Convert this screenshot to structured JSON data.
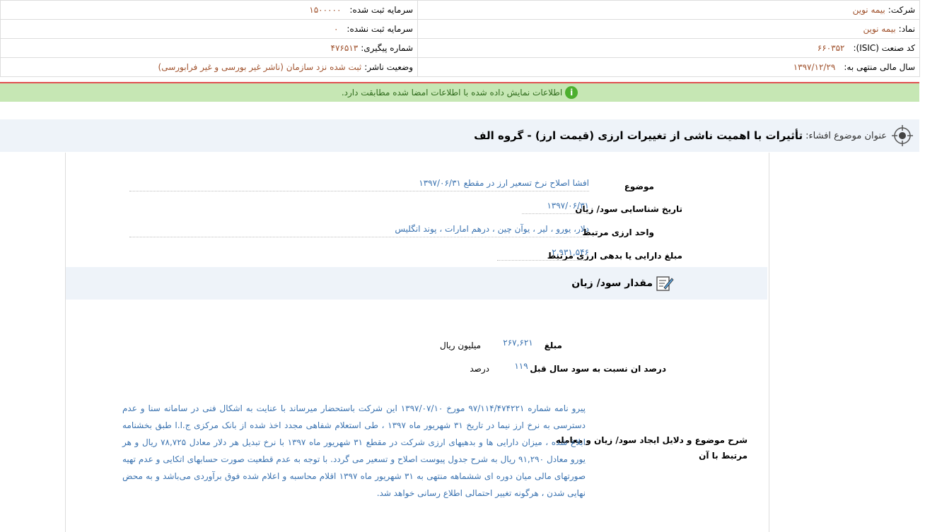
{
  "header": {
    "company_label": "شرکت:",
    "company_value": "بیمه نوین",
    "registered_capital_label": "سرمایه ثبت شده:",
    "registered_capital_value": "۱۵۰۰۰۰۰",
    "symbol_label": "نماد:",
    "symbol_value": "بیمه نوین",
    "unregistered_capital_label": "سرمایه ثبت نشده:",
    "unregistered_capital_value": "۰",
    "isic_label": "کد صنعت (ISIC):",
    "isic_value": "۶۶۰۳۵۲",
    "tracking_label": "شماره پیگیری:",
    "tracking_value": "۴۷۶۵۱۳",
    "fiscal_label": "سال مالی منتهی به:",
    "fiscal_value": "۱۳۹۷/۱۲/۲۹",
    "publisher_label": "وضعیت ناشر:",
    "publisher_value": "ثبت شده نزد سازمان (ناشر غیر بورسی و غیر فرابورسی)"
  },
  "notice": {
    "text": "اطلاعات نمایش داده شده با اطلاعات امضا شده مطابقت دارد.",
    "icon": "info-icon",
    "color": "#c6e7b4"
  },
  "title": {
    "label": "عنوان موضوع افشاء:",
    "text": "تأثیرات با اهمیت ناشی از تغییرات ارزی (قیمت ارز) - گروه الف"
  },
  "details": {
    "subject_label": "موضوع",
    "subject_value": "افشا اصلاح نرخ تسعیر ارز در مقطع ۱۳۹۷/۰۶/۳۱",
    "date_label": "تاریخ شناسایی سود/ زیان",
    "date_value": "۱۳۹۷/۰۶/۳۱",
    "currency_label": "واحد ارزی مرتبط",
    "currency_value": "دلار، یورو ، لیر ، یوآن چین ، درهم امارات ، پوند انگلیس",
    "amount_label": "مبلغ دارایی یا بدهی ارزی مرتبط",
    "amount_value": "۲,۹۳۱,۵۴۶"
  },
  "profit_section": {
    "title": "مقدار سود/ زیان",
    "amount_label": "مبلغ",
    "amount_value": "۲۶۷,۶۲۱",
    "amount_unit": "میلیون ریال",
    "percent_label": "درصد ان نسبت به سود سال قبل",
    "percent_value": "۱۱۹",
    "percent_unit": "درصد"
  },
  "description": {
    "label_line1": "شرح موضوع و دلایل ایجاد سود/ زیان و معامله",
    "label_line2": "مرتبط با آن",
    "text": "پیرو نامه شماره ۹۷/۱۱۴/۴۷۴۲۲۱ مورخ ۱۳۹۷/۰۷/۱۰ این شرکت باستحضار میرساند با عنایت به اشکال فنی در سامانه سنا و عدم دسترسی به نرخ ارز نیما در تاریخ ۳۱ شهریور ماه ۱۳۹۷ ، طی استعلام شفاهی مجدد اخذ شده از بانک مرکزی ج.ا.ا طبق بخشنامه ابلاغ شده ، میزان دارایی ها و بدهیهای ارزی شرکت در مقطع ۳۱ شهریور ماه ۱۳۹۷ با نرخ تبدیل هر دلار معادل ۷۸,۷۲۵ ریال و هر یورو معادل ۹۱,۲۹۰ ریال به شرح جدول پیوست اصلاح و تسعیر می گردد. با توجه به عدم قطعیت صورت حسابهای اتکایی و عدم تهیه صورتهای مالی میان دوره ای ششماهه منتهی به ۳۱ شهریور ماه ۱۳۹۷ اقلام محاسبه و اعلام شده فوق برآوردی می‌باشد و به محض نهایی شدن ، هرگونه تغییر احتمالی اطلاع رسانی خواهد شد."
  }
}
